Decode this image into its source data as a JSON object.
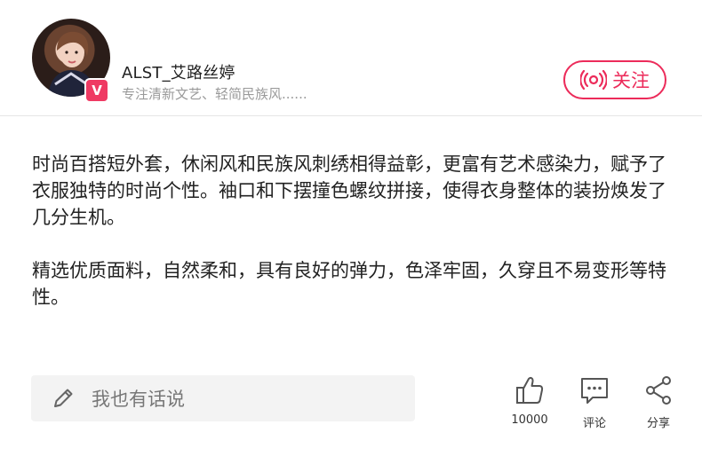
{
  "header": {
    "username": "ALST_艾路丝婷",
    "bio": "专注清新文艺、轻简民族风......",
    "badge_label": "V",
    "follow_label": "关注"
  },
  "content": {
    "paragraphs": [
      "时尚百搭短外套，休闲风和民族风刺绣相得益彰，更富有艺术感染力，赋予了衣服独特的时尚个性。袖口和下摆撞色螺纹拼接，使得衣身整体的装扮焕发了几分生机。",
      "精选优质面料，自然柔和，具有良好的弹力，色泽牢固，久穿且不易变形等特性。"
    ]
  },
  "footer": {
    "comment_placeholder": "我也有话说",
    "like_count": "10000",
    "comment_label": "评论",
    "share_label": "分享"
  },
  "colors": {
    "accent": "#ec2b5a",
    "divider": "#e6e6e6",
    "input_bg": "#f3f3f3"
  },
  "icons": {
    "avatar": "user-avatar-photo",
    "badge": "verified-v-icon",
    "follow": "broadcast-icon",
    "comment_input": "pencil-icon",
    "like": "thumbs-up-icon",
    "comment": "comment-bubble-icon",
    "share": "share-icon"
  }
}
